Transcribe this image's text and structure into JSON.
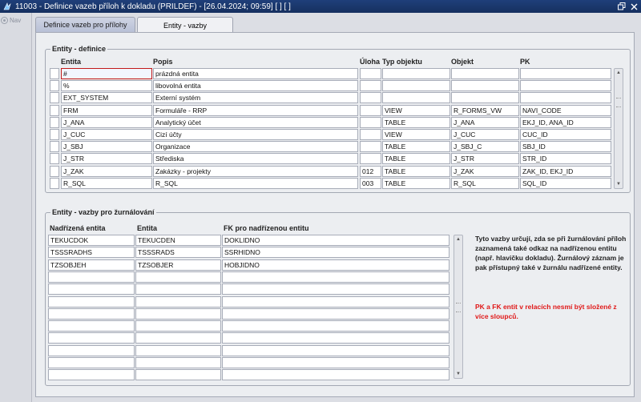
{
  "window": {
    "title": "11003 - Definice vazeb příloh k dokladu (PRILDEF) - [26.04.2024; 09:59]  [ ]  [ ]"
  },
  "nav": {
    "label": "Nav"
  },
  "tabs": [
    {
      "label": "Definice vazeb pro přílohy"
    },
    {
      "label": "Entity - vazby"
    }
  ],
  "entity_def": {
    "title": "Entity - definice",
    "columns": {
      "entita": "Entita",
      "popis": "Popis",
      "uloha": "Úloha",
      "typ": "Typ objektu",
      "objekt": "Objekt",
      "pk": "PK"
    },
    "rows": [
      {
        "entita": "#",
        "popis": "prázdná entita",
        "uloha": "",
        "typ": "",
        "objekt": "",
        "pk": ""
      },
      {
        "entita": "%",
        "popis": "libovolná entita",
        "uloha": "",
        "typ": "",
        "objekt": "",
        "pk": ""
      },
      {
        "entita": "EXT_SYSTEM",
        "popis": "Externí systém",
        "uloha": "",
        "typ": "",
        "objekt": "",
        "pk": ""
      },
      {
        "entita": "FRM",
        "popis": "Formuláře - RRP",
        "uloha": "",
        "typ": "VIEW",
        "objekt": "R_FORMS_VW",
        "pk": "NAVI_CODE"
      },
      {
        "entita": "J_ANA",
        "popis": "Analytický účet",
        "uloha": "",
        "typ": "TABLE",
        "objekt": "J_ANA",
        "pk": "EKJ_ID, ANA_ID"
      },
      {
        "entita": "J_CUC",
        "popis": "Cizí účty",
        "uloha": "",
        "typ": "VIEW",
        "objekt": "J_CUC",
        "pk": "CUC_ID"
      },
      {
        "entita": "J_SBJ",
        "popis": "Organizace",
        "uloha": "",
        "typ": "TABLE",
        "objekt": "J_SBJ_C",
        "pk": "SBJ_ID"
      },
      {
        "entita": "J_STR",
        "popis": "Střediska",
        "uloha": "",
        "typ": "TABLE",
        "objekt": "J_STR",
        "pk": "STR_ID"
      },
      {
        "entita": "J_ZAK",
        "popis": "Zakázky - projekty",
        "uloha": "012",
        "typ": "TABLE",
        "objekt": "J_ZAK",
        "pk": "ZAK_ID, EKJ_ID"
      },
      {
        "entita": "R_SQL",
        "popis": "R_SQL",
        "uloha": "003",
        "typ": "TABLE",
        "objekt": "R_SQL",
        "pk": "SQL_ID"
      }
    ]
  },
  "journal": {
    "title": "Entity - vazby pro žurnálování",
    "columns": {
      "nadrizena": "Nadřízená entita",
      "entita": "Entita",
      "fk": "FK pro nadřízenou entitu"
    },
    "rows": [
      {
        "nadrizena": "TEKUCDOK",
        "entita": "TEKUCDEN",
        "fk": "DOKLIDNO"
      },
      {
        "nadrizena": "TSSSRADHS",
        "entita": "TSSSRADS",
        "fk": "SSRHIDNO"
      },
      {
        "nadrizena": "TZSOBJEH",
        "entita": "TZSOBJER",
        "fk": "HOBJIDNO"
      },
      {
        "nadrizena": "",
        "entita": "",
        "fk": ""
      },
      {
        "nadrizena": "",
        "entita": "",
        "fk": ""
      },
      {
        "nadrizena": "",
        "entita": "",
        "fk": ""
      },
      {
        "nadrizena": "",
        "entita": "",
        "fk": ""
      },
      {
        "nadrizena": "",
        "entita": "",
        "fk": ""
      },
      {
        "nadrizena": "",
        "entita": "",
        "fk": ""
      },
      {
        "nadrizena": "",
        "entita": "",
        "fk": ""
      },
      {
        "nadrizena": "",
        "entita": "",
        "fk": ""
      },
      {
        "nadrizena": "",
        "entita": "",
        "fk": ""
      }
    ]
  },
  "info": {
    "text": "Tyto vazby určují, zda se při žurnálování příloh zaznamená také odkaz na nadřízenou entitu (např. hlavičku dokladu). Žurnálový záznam je pak přístupný také v žurnálu nadřízené entity.",
    "warning": "PK a FK entit v relacích nesmí být složené z více sloupců."
  },
  "colors": {
    "titlebar": "#1f3f7a",
    "focus_border": "#c21a1a",
    "warning": "#e01818"
  }
}
